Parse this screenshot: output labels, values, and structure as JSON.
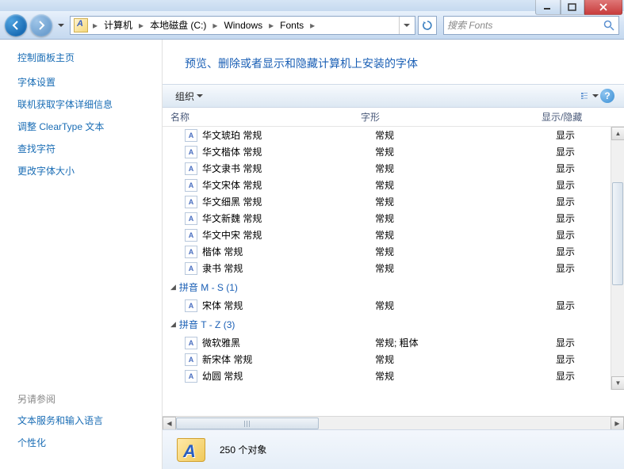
{
  "breadcrumbs": [
    "计算机",
    "本地磁盘 (C:)",
    "Windows",
    "Fonts"
  ],
  "search_placeholder": "搜索 Fonts",
  "sidebar": {
    "title": "控制面板主页",
    "links": [
      "字体设置",
      "联机获取字体详细信息",
      "调整 ClearType 文本",
      "查找字符",
      "更改字体大小"
    ],
    "see_also_label": "另请参阅",
    "see_also": [
      "文本服务和输入语言",
      "个性化"
    ]
  },
  "heading": "预览、删除或者显示和隐藏计算机上安装的字体",
  "toolbar": {
    "organize": "组织"
  },
  "columns": {
    "name": "名称",
    "style": "字形",
    "show": "显示/隐藏"
  },
  "rows_a": [
    {
      "name": "华文琥珀 常规",
      "style": "常规",
      "show": "显示"
    },
    {
      "name": "华文楷体 常规",
      "style": "常规",
      "show": "显示"
    },
    {
      "name": "华文隶书 常规",
      "style": "常规",
      "show": "显示"
    },
    {
      "name": "华文宋体 常规",
      "style": "常规",
      "show": "显示"
    },
    {
      "name": "华文细黑 常规",
      "style": "常规",
      "show": "显示"
    },
    {
      "name": "华文新魏 常规",
      "style": "常规",
      "show": "显示"
    },
    {
      "name": "华文中宋 常规",
      "style": "常规",
      "show": "显示"
    },
    {
      "name": "楷体 常规",
      "style": "常规",
      "show": "显示"
    },
    {
      "name": "隶书 常规",
      "style": "常规",
      "show": "显示"
    }
  ],
  "group_ms": "拼音 M - S (1)",
  "rows_ms": [
    {
      "name": "宋体 常规",
      "style": "常规",
      "show": "显示"
    }
  ],
  "group_tz": "拼音 T - Z (3)",
  "rows_tz": [
    {
      "name": "微软雅黑",
      "style": "常规; 粗体",
      "show": "显示"
    },
    {
      "name": "新宋体 常规",
      "style": "常规",
      "show": "显示"
    },
    {
      "name": "幼圆 常规",
      "style": "常规",
      "show": "显示"
    }
  ],
  "status": "250 个对象"
}
